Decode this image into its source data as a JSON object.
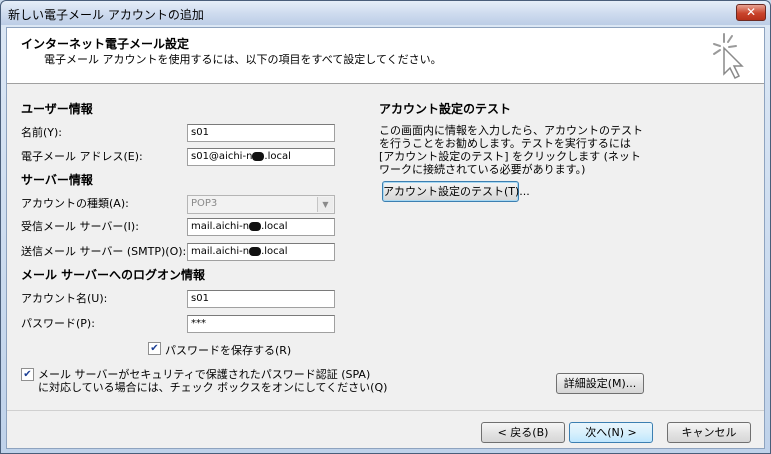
{
  "window": {
    "title": "新しい電子メール アカウントの追加",
    "close_label": "✕"
  },
  "header": {
    "title": "インターネット電子メール設定",
    "subtitle": "電子メール アカウントを使用するには、以下の項目をすべて設定してください。"
  },
  "user_info": {
    "heading": "ユーザー情報",
    "name_label": "名前(Y):",
    "name_value": "s01",
    "email_label": "電子メール アドレス(E):",
    "email_value_prefix": "s01@aichi-n",
    "email_value_suffix": ".local"
  },
  "server_info": {
    "heading": "サーバー情報",
    "account_type_label": "アカウントの種類(A):",
    "account_type_value": "POP3",
    "incoming_label": "受信メール サーバー(I):",
    "incoming_value_prefix": "mail.aichi-n",
    "incoming_value_suffix": ".local",
    "outgoing_label": "送信メール サーバー (SMTP)(O):",
    "outgoing_value_prefix": "mail.aichi-n",
    "outgoing_value_suffix": ".local"
  },
  "logon_info": {
    "heading": "メール サーバーへのログオン情報",
    "account_name_label": "アカウント名(U):",
    "account_name_value": "s01",
    "password_label": "パスワード(P):",
    "password_value": "***",
    "save_password_label": "パスワードを保存する(R)",
    "save_password_checked": true,
    "spa_label_line1": "メール サーバーがセキュリティで保護されたパスワード認証 (SPA)",
    "spa_label_line2": "に対応している場合には、チェック ボックスをオンにしてください(Q)",
    "spa_checked": true
  },
  "test_settings": {
    "heading": "アカウント設定のテスト",
    "description": "この画面内に情報を入力したら、アカウントのテストを行うことをお勧めします。テストを実行するには [アカウント設定のテスト] をクリックします (ネットワークに接続されている必要があります。)",
    "test_button": "アカウント設定のテスト(T)..."
  },
  "more_settings_button": "詳細設定(M)...",
  "footer": {
    "back_button": "< 戻る(B)",
    "next_button": "次へ(N) >",
    "cancel_button": "キャンセル"
  },
  "checkmark": "✔"
}
